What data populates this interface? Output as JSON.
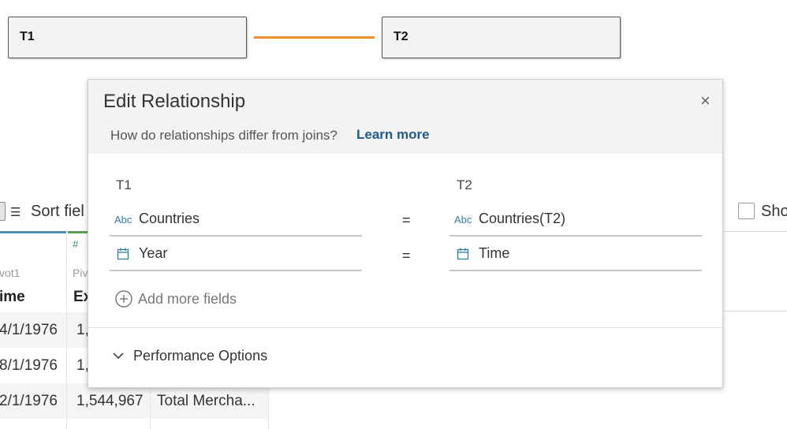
{
  "canvas": {
    "left_table": "T1",
    "right_table": "T2",
    "relationship_color": "#f28e2b"
  },
  "grid": {
    "sort_label": "Sort fiel",
    "show_label": "Sho",
    "num_type_icon": "#",
    "pivot_label_1": "vot1",
    "pivot_label_2": "Piv",
    "col1_header": "ime",
    "col2_header": "Ex",
    "rows": [
      {
        "c1": "4/1/1976",
        "c2": "1,",
        "c3": ""
      },
      {
        "c1": "8/1/1976",
        "c2": "1,",
        "c3": ""
      },
      {
        "c1": "2/1/1976",
        "c2": "1,544,967",
        "c3": "Total Mercha..."
      }
    ]
  },
  "dialog": {
    "title": "Edit Relationship",
    "close_icon": "×",
    "subtitle": "How do relationships differ from joins?",
    "learn_more": "Learn more",
    "left_table": "T1",
    "right_table": "T2",
    "pairs": [
      {
        "left_type": "Abc",
        "left_field": "Countries",
        "operator": "=",
        "right_type": "Abc",
        "right_field": "Countries(T2)"
      },
      {
        "left_type": "calendar",
        "left_field": "Year",
        "operator": "=",
        "right_type": "calendar",
        "right_field": "Time"
      }
    ],
    "add_more": "Add more fields",
    "performance": "Performance Options"
  }
}
